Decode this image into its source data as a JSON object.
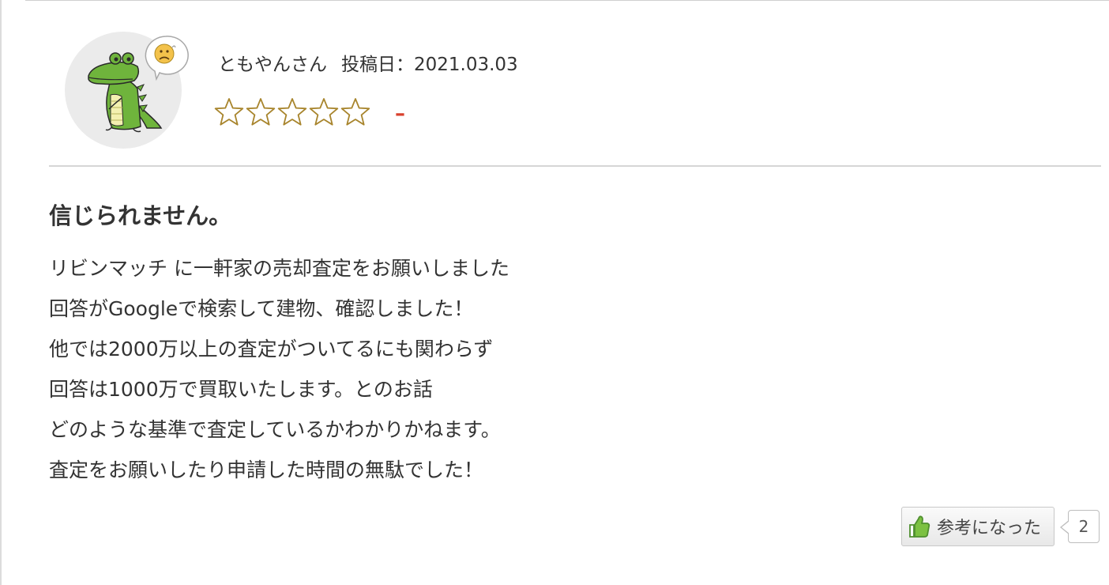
{
  "review": {
    "reviewer_name": "ともやんさん",
    "posted_date_label": "投稿日：2021.03.03",
    "rating": {
      "stars_filled": 0,
      "stars_total": 5,
      "display_value": "–",
      "star_color": "#a8852d",
      "value_color": "#d9412e"
    },
    "avatar": {
      "icon": "crocodile-mascot",
      "mood_icon": "sad-face-icon"
    },
    "title": "信じられません。",
    "body_lines": [
      "リビンマッチ に一軒家の売却査定をお願いしました",
      "回答がGoogleで検索して建物、確認しました！",
      "他では2000万以上の査定がついてるにも関わらず",
      "回答は1000万で買取いたします。とのお話",
      "どのような基準で査定しているかわかりかねます。",
      "査定をお願いしたり申請した時間の無駄でした！"
    ],
    "helpful": {
      "icon": "thumbs-up-icon",
      "label": "参考になった",
      "count": "2"
    }
  }
}
